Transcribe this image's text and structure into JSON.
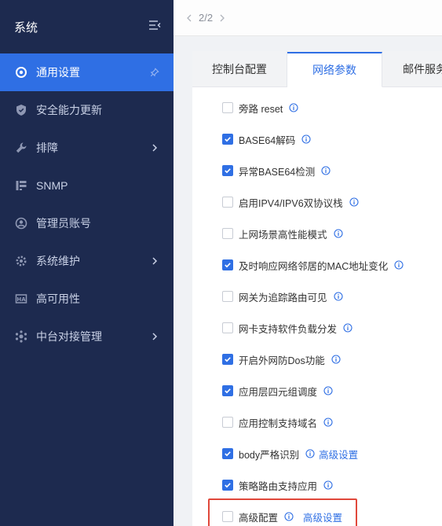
{
  "sidebar": {
    "title": "系统",
    "items": [
      {
        "label": "通用设置",
        "icon": "target-icon",
        "active": true
      },
      {
        "label": "安全能力更新",
        "icon": "shield-icon"
      },
      {
        "label": "排障",
        "icon": "wrench-icon",
        "has_children": true
      },
      {
        "label": "SNMP",
        "icon": "snmp-icon"
      },
      {
        "label": "管理员账号",
        "icon": "user-circle-icon"
      },
      {
        "label": "系统维护",
        "icon": "gear-icon",
        "has_children": true
      },
      {
        "label": "高可用性",
        "icon": "ha-icon"
      },
      {
        "label": "中台对接管理",
        "icon": "hub-icon",
        "has_children": true
      }
    ]
  },
  "topbar": {
    "page": "2/2"
  },
  "tabs": [
    {
      "label": "控制台配置"
    },
    {
      "label": "网络参数",
      "active": true
    },
    {
      "label": "邮件服务"
    }
  ],
  "options": [
    {
      "label": "旁路 reset",
      "checked": false
    },
    {
      "label": "BASE64解码",
      "checked": true
    },
    {
      "label": "异常BASE64检测",
      "checked": true
    },
    {
      "label": "启用IPV4/IPV6双协议栈",
      "checked": false
    },
    {
      "label": "上网场景高性能模式",
      "checked": false
    },
    {
      "label": "及时响应网络邻居的MAC地址变化",
      "checked": true
    },
    {
      "label": "网关为追踪路由可见",
      "checked": false
    },
    {
      "label": "网卡支持软件负载分发",
      "checked": false
    },
    {
      "label": "开启外网防Dos功能",
      "checked": true
    },
    {
      "label": "应用层四元组调度",
      "checked": true
    },
    {
      "label": "应用控制支持域名",
      "checked": false
    },
    {
      "label": "body严格识别",
      "checked": true,
      "link": "高级设置"
    },
    {
      "label": "策略路由支持应用",
      "checked": true
    },
    {
      "label": "高级配置",
      "checked": false,
      "link": "高级设置",
      "highlighted": true
    }
  ],
  "colors": {
    "accent": "#2f6fe4",
    "sidebar_bg": "#1d2a4f",
    "highlight": "#e0483b"
  }
}
